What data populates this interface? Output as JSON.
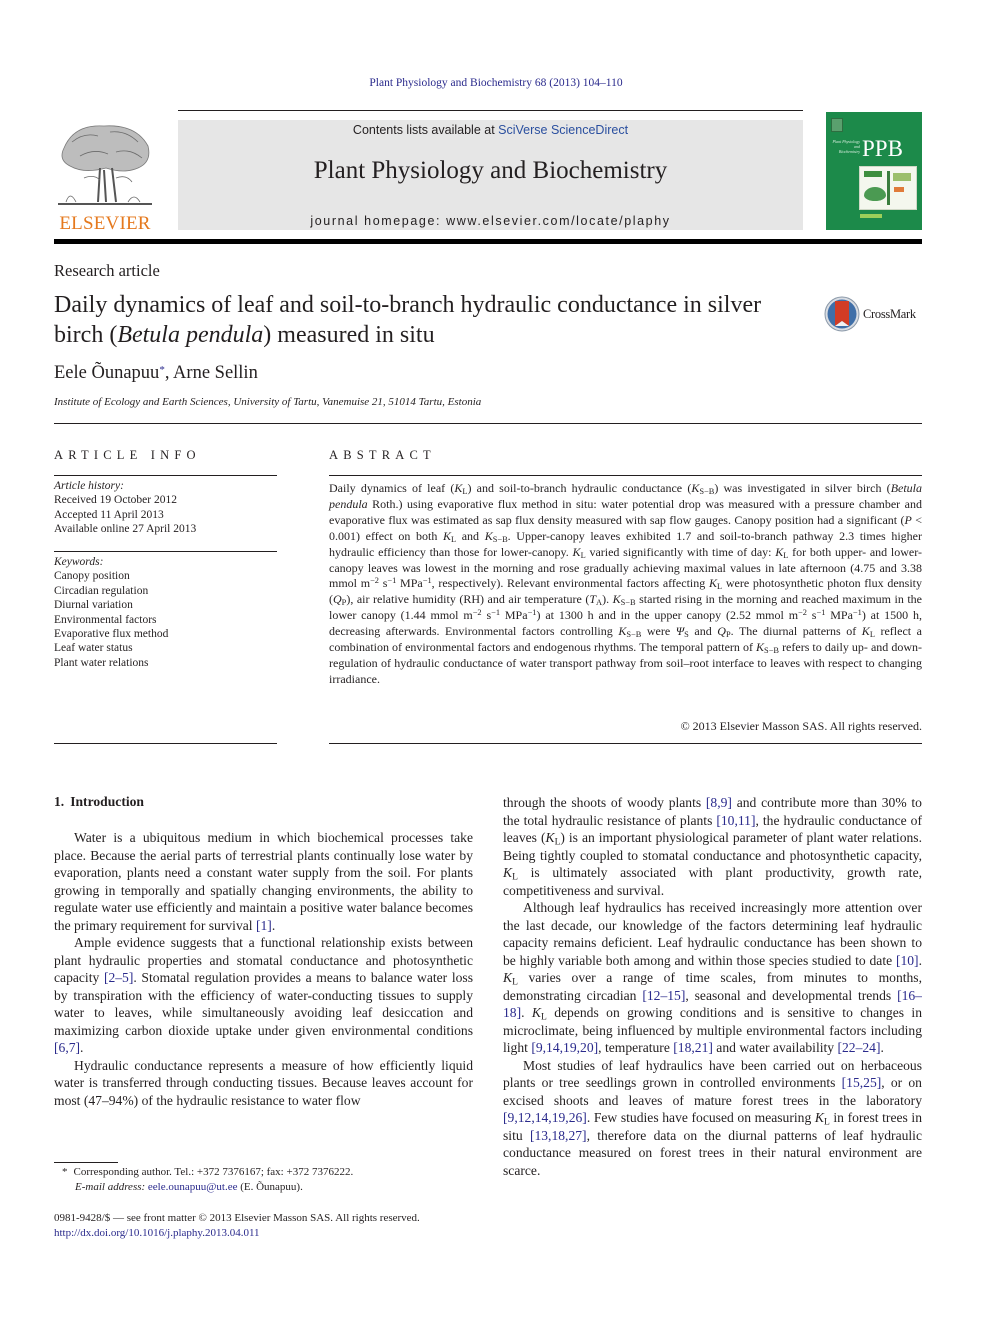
{
  "journal_reference": "Plant Physiology and Biochemistry 68 (2013) 104–110",
  "masthead": {
    "publisher": "ELSEVIER",
    "contents_prefix": "Contents lists available at ",
    "contents_link": "SciVerse ScienceDirect",
    "journal_title": "Plant Physiology and Biochemistry",
    "homepage_label": "journal homepage: www.elsevier.com/locate/plaphy",
    "cover_abbrev": "PPB",
    "cover_subtitle": "Plant Physiology and Biochemistry",
    "colors": {
      "elsevier_orange": "#e5791e",
      "cover_green": "#1c8a4a",
      "link_blue": "#2a2a8c",
      "masthead_gray": "#e6e6e6"
    }
  },
  "article": {
    "type": "Research article",
    "title_part1": "Daily dynamics of leaf and soil-to-branch hydraulic conductance in silver birch (",
    "title_italic": "Betula pendula",
    "title_part2": ") measured in situ",
    "crossmark_label": "CrossMark",
    "authors": [
      {
        "name": "Eele Õunapuu",
        "marker": "*",
        "separator": ", "
      },
      {
        "name": "Arne Sellin",
        "marker": "",
        "separator": ""
      }
    ],
    "affiliation": "Institute of Ecology and Earth Sciences, University of Tartu, Vanemuise 21, 51014 Tartu, Estonia"
  },
  "article_info": {
    "heading": "ARTICLE INFO",
    "history_label": "Article history:",
    "history": [
      "Received 19 October 2012",
      "Accepted 11 April 2013",
      "Available online 27 April 2013"
    ],
    "keywords_label": "Keywords:",
    "keywords": [
      "Canopy position",
      "Circadian regulation",
      "Diurnal variation",
      "Environmental factors",
      "Evaporative flux method",
      "Leaf water status",
      "Plant water relations"
    ]
  },
  "abstract": {
    "heading": "ABSTRACT",
    "copyright": "© 2013 Elsevier Masson SAS. All rights reserved."
  },
  "introduction": {
    "number": "1.",
    "heading": "Introduction"
  },
  "footnote": {
    "star": "*",
    "corresponding": "Corresponding author. Tel.: +372 7376167; fax: +372 7376222.",
    "email_label": "E-mail address:",
    "email": "eele.ounapuu@ut.ee",
    "email_suffix": "(E. Õunapuu)."
  },
  "front_matter": {
    "issn_line": "0981-9428/$ — see front matter © 2013 Elsevier Masson SAS. All rights reserved.",
    "doi": "http://dx.doi.org/10.1016/j.plaphy.2013.04.011"
  }
}
